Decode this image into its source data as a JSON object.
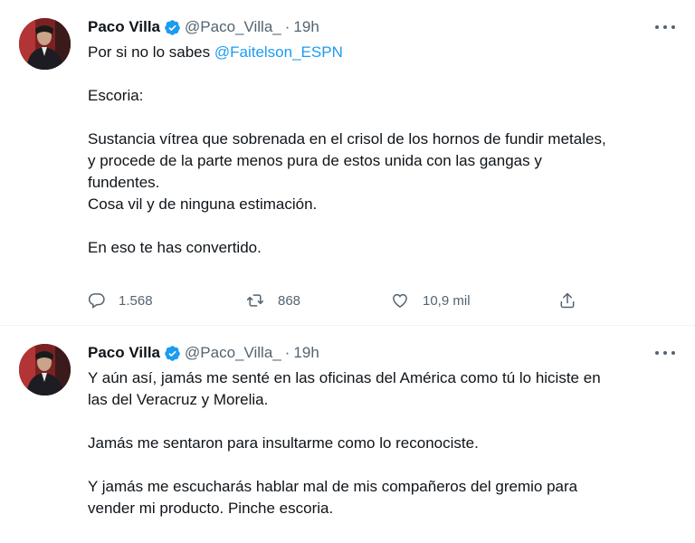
{
  "colors": {
    "text": "#0f1419",
    "muted": "#536471",
    "link": "#1d9bf0",
    "verified": "#1d9bf0",
    "divider": "#eff3f4"
  },
  "tweets": [
    {
      "author": {
        "name": "Paco Villa",
        "handle": "@Paco_Villa_",
        "verified_icon": "verified-badge-icon"
      },
      "separator": "·",
      "time": "19h",
      "more_icon": "more-horizontal-icon",
      "paragraphs": [
        {
          "lines": [
            {
              "prefix": "Por si no lo sabes ",
              "mention": "@Faitelson_ESPN"
            }
          ]
        },
        {
          "lines": [
            {
              "text": "Escoria:"
            }
          ]
        },
        {
          "lines": [
            {
              "text": "Sustancia vítrea que sobrenada en el crisol de los hornos de fundir metales,"
            },
            {
              "text": "y procede de la parte menos pura de estos unida con las gangas y"
            },
            {
              "text": "fundentes."
            },
            {
              "text": "Cosa vil y de ninguna estimación."
            }
          ]
        },
        {
          "lines": [
            {
              "text": "En eso te has convertido."
            }
          ]
        }
      ],
      "actions": {
        "reply": {
          "icon": "reply-icon",
          "count": "1.568"
        },
        "retweet": {
          "icon": "retweet-icon",
          "count": "868"
        },
        "like": {
          "icon": "like-icon",
          "count": "10,9 mil"
        },
        "share": {
          "icon": "share-icon"
        }
      }
    },
    {
      "author": {
        "name": "Paco Villa",
        "handle": "@Paco_Villa_",
        "verified_icon": "verified-badge-icon"
      },
      "separator": "·",
      "time": "19h",
      "more_icon": "more-horizontal-icon",
      "paragraphs": [
        {
          "lines": [
            {
              "text": "Y aún así, jamás me senté en las oficinas del América como tú lo hiciste en"
            },
            {
              "text": "las del Veracruz y Morelia."
            }
          ]
        },
        {
          "lines": [
            {
              "text": "Jamás me sentaron para insultarme como lo reconociste."
            }
          ]
        },
        {
          "lines": [
            {
              "text": "Y jamás me escucharás hablar mal de mis compañeros del gremio para"
            },
            {
              "text": "vender mi producto. Pinche escoria."
            }
          ]
        }
      ]
    }
  ]
}
